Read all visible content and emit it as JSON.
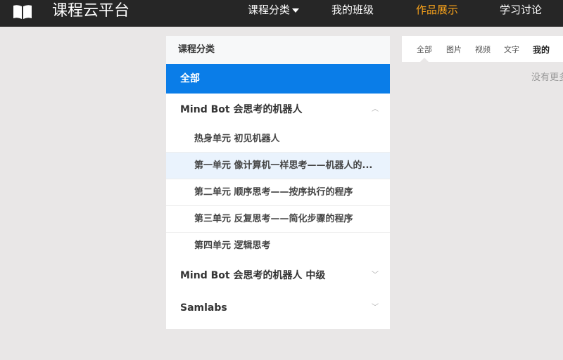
{
  "header": {
    "brand": "课程云平台",
    "nav": [
      "课程分类",
      "我的班级",
      "作品展示",
      "学习讨论"
    ],
    "active_color": "#f7a21b"
  },
  "sidebar": {
    "title": "课程分类",
    "all": "全部",
    "groups": [
      {
        "label": "Mind Bot 会思考的机器人",
        "expanded": true,
        "items": [
          "热身单元 初见机器人",
          "第一单元 像计算机一样思考——机器人的...",
          "第二单元 顺序思考——按序执行的程序",
          "第三单元 反复思考——简化步骤的程序",
          "第四单元 逻辑思考"
        ]
      },
      {
        "label": "Mind Bot 会思考的机器人 中级",
        "expanded": false
      },
      {
        "label": "Samlabs",
        "expanded": false
      }
    ]
  },
  "tabs": [
    "全部",
    "图片",
    "视频",
    "文字",
    "我的"
  ],
  "empty_text": "没有更多"
}
